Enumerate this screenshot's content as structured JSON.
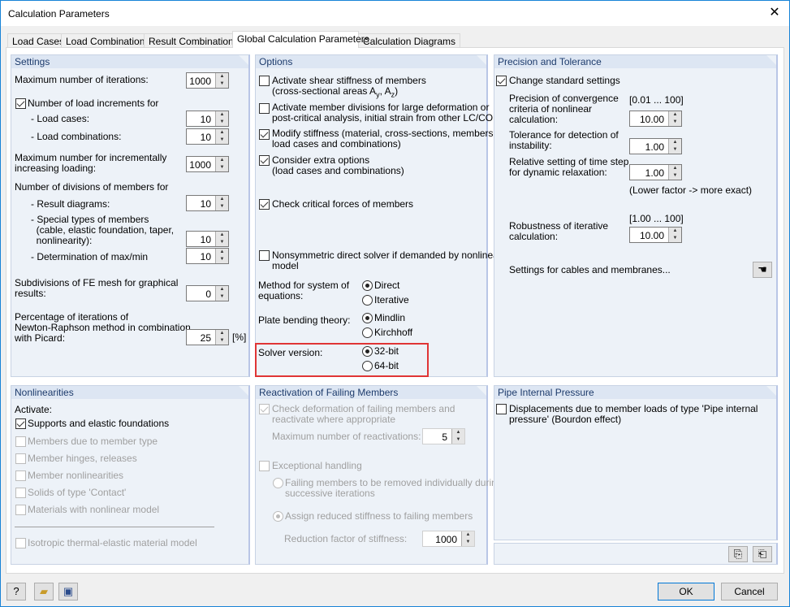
{
  "window": {
    "title": "Calculation Parameters",
    "close": "✕"
  },
  "tabs": [
    "Load Cases",
    "Load Combinations",
    "Result Combinations",
    "Global Calculation Parameters",
    "Calculation Diagrams"
  ],
  "settings": {
    "title": "Settings",
    "max_iter_label": "Maximum number of iterations:",
    "max_iter": "1000",
    "load_incr_label": "Number of load increments for",
    "load_incr_checked": true,
    "load_cases_label": "- Load cases:",
    "load_cases": "10",
    "load_combos_label": "- Load combinations:",
    "load_combos": "10",
    "max_incr_label": "Maximum number for incrementally\nincreasing loading:",
    "max_incr": "1000",
    "divisions_label": "Number of divisions of members for",
    "result_diag_label": "- Result diagrams:",
    "result_diag": "10",
    "special_label": "- Special types of members\n  (cable, elastic foundation, taper,\n  nonlinearity):",
    "special": "10",
    "maxmin_label": "- Determination of max/min",
    "maxmin": "10",
    "fe_mesh_label": "Subdivisions of FE mesh for graphical\nresults:",
    "fe_mesh": "0",
    "picard_label": "Percentage of iterations of\nNewton-Raphson method in combination\nwith Picard:",
    "picard": "25",
    "picard_unit": "[%]"
  },
  "options": {
    "title": "Options",
    "shear_l1": "Activate shear stiffness of members",
    "shear_l2a": "(cross-sectional areas A",
    "shear_sub1": "y",
    "shear_l2b": ", A",
    "shear_sub2": "z",
    "shear_l2c": ")",
    "shear_checked": false,
    "divisions": "Activate member divisions for large deformation or\npost-critical analysis, initial strain from other LC/CO",
    "divisions_checked": false,
    "modify": "Modify stiffness (material, cross-sections, members,\nload cases and combinations)",
    "modify_checked": true,
    "extra": "Consider extra options\n(load cases and combinations)",
    "extra_checked": true,
    "critical": "Check critical forces of members",
    "critical_checked": true,
    "nonsym": "Nonsymmetric direct solver if demanded by nonlinear\nmodel",
    "nonsym_checked": false,
    "method_label": "Method for system of\nequations:",
    "method_options": [
      "Direct",
      "Iterative"
    ],
    "method_selected": "Direct",
    "plate_label": "Plate bending theory:",
    "plate_options": [
      "Mindlin",
      "Kirchhoff"
    ],
    "plate_selected": "Mindlin",
    "solver_label": "Solver version:",
    "solver_options": [
      "32-bit",
      "64-bit"
    ],
    "solver_selected": "32-bit"
  },
  "precision": {
    "title": "Precision and Tolerance",
    "change_label": "Change standard settings",
    "change_checked": true,
    "conv_label": "Precision of convergence\ncriteria of nonlinear\ncalculation:",
    "conv_range": "[0.01 ... 100]",
    "conv": "10.00",
    "tol_label": "Tolerance for detection of\ninstability:",
    "tol": "1.00",
    "time_label": "Relative setting of time step\nfor dynamic relaxation:",
    "time": "1.00",
    "hint": "(Lower factor -> more exact)",
    "rob_range": "[1.00 ... 100]",
    "rob_label": "Robustness of iterative\ncalculation:",
    "rob": "10.00",
    "cables_label": "Settings for cables and membranes..."
  },
  "nonlin": {
    "title": "Nonlinearities",
    "activate": "Activate:",
    "items": [
      {
        "label": "Supports and elastic foundations",
        "checked": true,
        "enabled": true
      },
      {
        "label": "Members due to member type",
        "checked": false,
        "enabled": false
      },
      {
        "label": "Member hinges, releases",
        "checked": false,
        "enabled": false
      },
      {
        "label": "Member nonlinearities",
        "checked": false,
        "enabled": false
      },
      {
        "label": "Solids of type 'Contact'",
        "checked": false,
        "enabled": false
      },
      {
        "label": "Materials with nonlinear model",
        "checked": false,
        "enabled": false
      },
      {
        "label": "Isotropic thermal-elastic material model",
        "checked": false,
        "enabled": false
      }
    ]
  },
  "react": {
    "title": "Reactivation of Failing Members",
    "check_label": "Check deformation of failing members and\nreactivate where appropriate",
    "check_checked": true,
    "max_label": "Maximum number of reactivations:",
    "max": "5",
    "exc_label": "Exceptional handling",
    "exc_checked": false,
    "opt1": "Failing members to be removed individually during\nsuccessive iterations",
    "opt2": "Assign reduced stiffness to failing members",
    "selected": "opt2",
    "red_label": "Reduction factor of stiffness:",
    "red": "1000"
  },
  "pipe": {
    "title": "Pipe Internal Pressure",
    "label": "Displacements due to member loads of type 'Pipe internal\npressure' (Bourdon effect)",
    "checked": false
  },
  "footer": {
    "ok": "OK",
    "cancel": "Cancel"
  },
  "colors": {
    "accent": "#0078d7",
    "highlight": "#e03535",
    "panel_header": "#dde6f3"
  }
}
